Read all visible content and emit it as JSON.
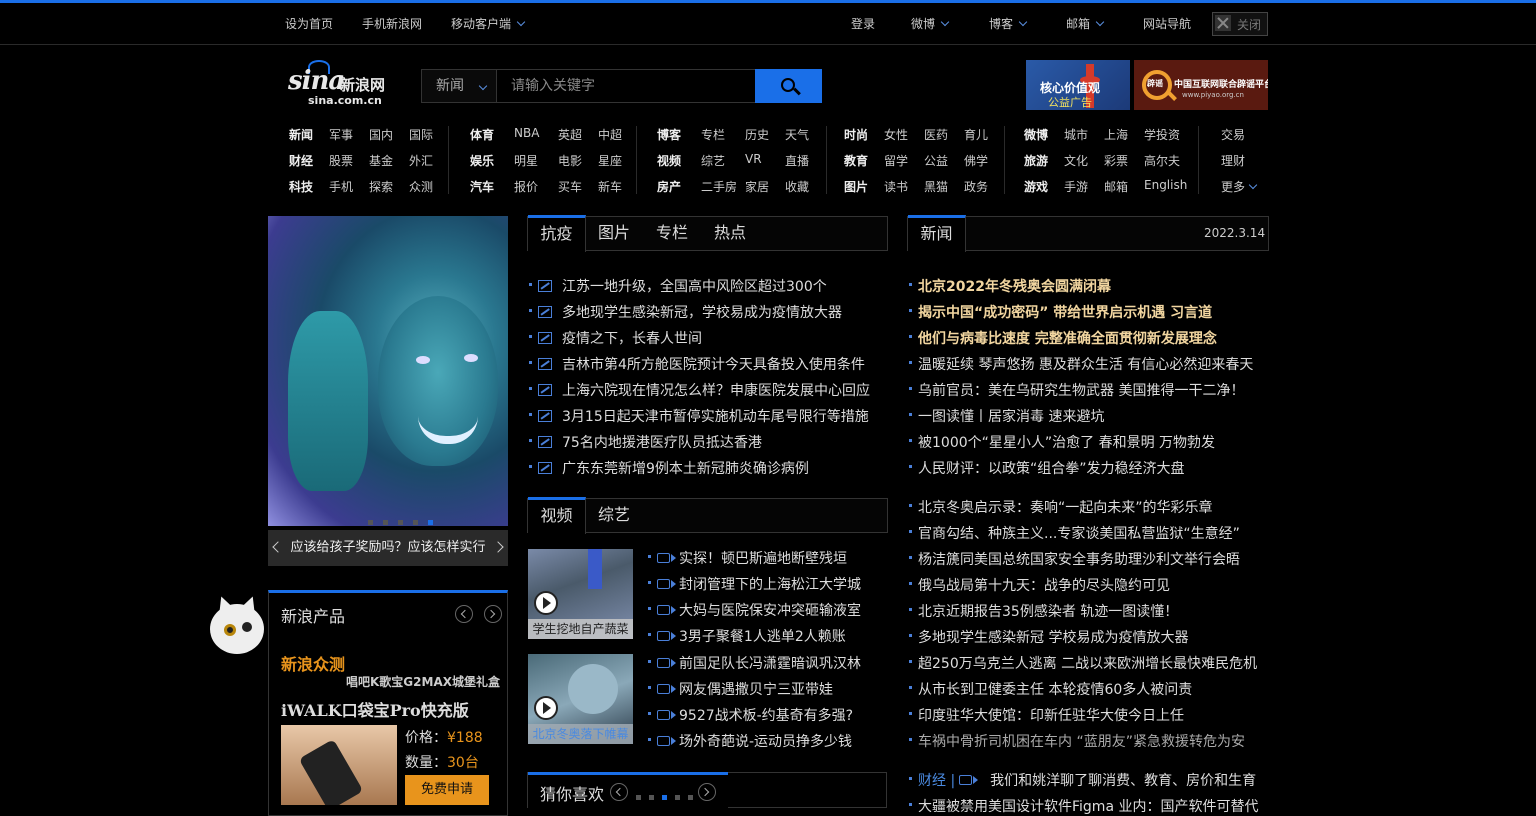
{
  "topbar": {
    "left": [
      "设为首页",
      "手机新浪网",
      "移动客户端"
    ],
    "right": [
      "登录",
      "微博",
      "博客",
      "邮箱",
      "网站导航"
    ],
    "close_label": "关闭"
  },
  "logo": {
    "mark": "sina",
    "cn": "新浪网",
    "domain": "sina.com.cn"
  },
  "search": {
    "category": "新闻",
    "placeholder": "请输入关键字"
  },
  "ads": {
    "ad1_line1": "核心价值观",
    "ad1_line2": "公益广告",
    "ad2_line1": "中国互联网联合辟谣平台",
    "ad2_line2": "www.piyao.org.cn",
    "ad2_badge": "辟谣"
  },
  "nav": {
    "col1": [
      [
        "新闻",
        "军事",
        "国内",
        "国际"
      ],
      [
        "财经",
        "股票",
        "基金",
        "外汇"
      ],
      [
        "科技",
        "手机",
        "探索",
        "众测"
      ]
    ],
    "col2": [
      [
        "体育",
        "NBA",
        "英超",
        "中超"
      ],
      [
        "娱乐",
        "明星",
        "电影",
        "星座"
      ],
      [
        "汽车",
        "报价",
        "买车",
        "新车"
      ]
    ],
    "col3": [
      [
        "博客",
        "专栏",
        "历史",
        "天气"
      ],
      [
        "视频",
        "综艺",
        "VR",
        "直播"
      ],
      [
        "房产",
        "二手房",
        "家居",
        "收藏"
      ]
    ],
    "col4": [
      [
        "时尚",
        "女性",
        "医药",
        "育儿"
      ],
      [
        "教育",
        "留学",
        "公益",
        "佛学"
      ],
      [
        "图片",
        "读书",
        "黑猫",
        "政务"
      ]
    ],
    "col5": [
      [
        "微博",
        "城市",
        "上海",
        "学投资"
      ],
      [
        "旅游",
        "文化",
        "彩票",
        "高尔夫"
      ],
      [
        "游戏",
        "手游",
        "邮箱",
        "English"
      ]
    ],
    "col6": [
      "交易",
      "理财",
      "更多"
    ]
  },
  "slider": {
    "caption": "应该给孩子奖励吗？应该怎样实行"
  },
  "center_tabs": [
    "抗疫",
    "图片",
    "专栏",
    "热点"
  ],
  "center_list": [
    "江苏一地升级，全国高中风险区超过300个",
    "多地现学生感染新冠，学校易成为疫情放大器",
    "疫情之下，长春人世间",
    "吉林市第4所方舱医院预计今天具备投入使用条件",
    "上海六院现在情况怎么样？申康医院发展中心回应",
    "3月15日起天津市暂停实施机动车尾号限行等措施",
    "75名内地援港医疗队员抵达香港",
    "广东东莞新增9例本土新冠肺炎确诊病例"
  ],
  "video_tabs": [
    "视频",
    "综艺"
  ],
  "video_thumbs": [
    "学生挖地自产蔬菜",
    "北京冬奥落下帷幕"
  ],
  "video_list": [
    "实探！顿巴斯遍地断壁残垣",
    "封闭管理下的上海松江大学城",
    "大妈与医院保安冲突砸输液室",
    "3男子聚餐1人逃单2人赖账",
    "前国足队长冯潇霆暗讽巩汉林",
    "网友偶遇撒贝宁三亚带娃",
    "9527战术板-约基奇有多强?",
    "场外奇葩说-运动员挣多少钱"
  ],
  "news": {
    "tab": "新闻",
    "date": "2022.3.14"
  },
  "news_headlines": [
    "北京2022年冬残奥会圆满闭幕",
    "揭示中国“成功密码” 带给世界启示机遇 习言道",
    "他们与病毒比速度 完整准确全面贯彻新发展理念"
  ],
  "news_list1": [
    "温暖延续 琴声悠扬 惠及群众生活 有信心必然迎来春天",
    "乌前官员：美在乌研究生物武器 美国推得一干二净！",
    "一图读懂丨居家消毒 速来避坑",
    "被1000个“星星小人”治愈了 春和景明 万物勃发",
    "人民财评：以政策“组合拳”发力稳经济大盘"
  ],
  "news_list2": [
    "北京冬奥启示录：奏响“一起向未来”的华彩乐章",
    "官商勾结、种族主义...专家谈美国私营监狱“生意经”",
    "杨洁篪同美国总统国家安全事务助理沙利文举行会晤",
    "俄乌战局第十九天：战争的尽头隐约可见",
    "北京近期报告35例感染者 轨迹一图读懂！",
    "多地现学生感染新冠 学校易成为疫情放大器",
    "超250万乌克兰人逃离 二战以来欧洲增长最快难民危机",
    "从市长到卫健委主任 本轮疫情60多人被问责",
    "印度驻华大使馆：印新任驻华大使今日上任",
    "车祸中骨折司机困在车内 “蓝朋友”紧急救援转危为安"
  ],
  "finance": {
    "label": "财经 |",
    "line1": "我们和姚洋聊了聊消费、教育、房价和生育",
    "line2": "大疆被禁用美国设计软件Figma 业内：国产软件可替代"
  },
  "products": {
    "title": "新浪产品",
    "zhongce": "新浪众测",
    "promo": "唱吧K歌宝G2MAX城堡礼盒",
    "item": "iWALK口袋宝Pro快充版",
    "price_label": "价格：",
    "price": "¥188",
    "qty_label": "数量：",
    "qty": "30台",
    "apply": "免费申请"
  },
  "guess": {
    "title": "猜你喜欢"
  },
  "colors": {
    "accent": "#1a6fe8",
    "headline": "#f2d6a0",
    "orange": "#e8941c"
  }
}
